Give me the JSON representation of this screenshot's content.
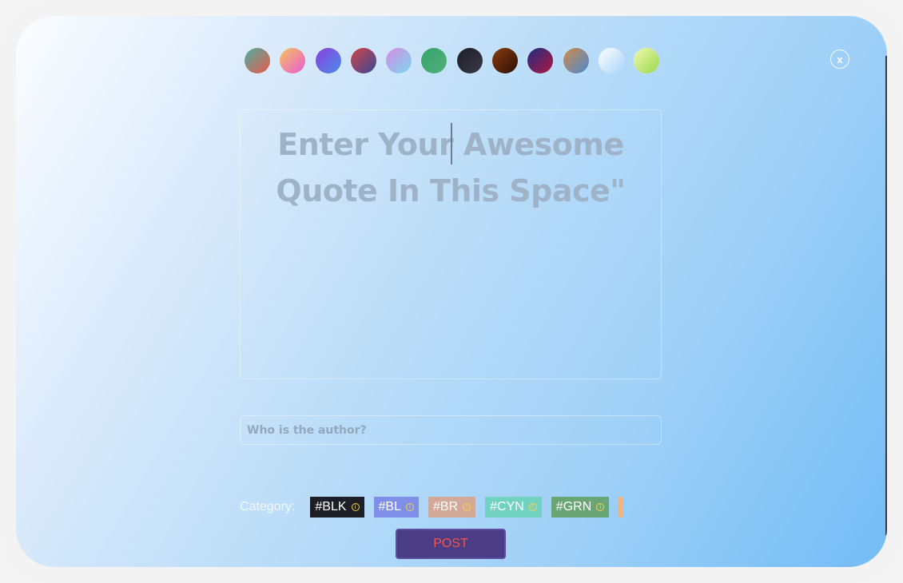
{
  "dialog": {
    "close_label": "x"
  },
  "color_swatches": [
    {
      "name": "teal-coral",
      "gradient": [
        "#4fb0a2",
        "#e8584a"
      ]
    },
    {
      "name": "orange-pink",
      "gradient": [
        "#f6c25b",
        "#e85bd6"
      ]
    },
    {
      "name": "violet-blue",
      "gradient": [
        "#8a3fe0",
        "#4a8fe8"
      ]
    },
    {
      "name": "red-indigo",
      "gradient": [
        "#d04344",
        "#3a4a9a"
      ]
    },
    {
      "name": "lilac-cyan",
      "gradient": [
        "#d68be0",
        "#7ad7f0"
      ]
    },
    {
      "name": "green",
      "gradient": [
        "#35a46a",
        "#52b07a"
      ]
    },
    {
      "name": "charcoal",
      "gradient": [
        "#1e1e2a",
        "#3a3a48"
      ]
    },
    {
      "name": "brown",
      "gradient": [
        "#8a3e10",
        "#2a0e04"
      ]
    },
    {
      "name": "navy-crimson",
      "gradient": [
        "#1d2d80",
        "#b01840"
      ]
    },
    {
      "name": "bronze-blue",
      "gradient": [
        "#d08a4a",
        "#4a8ad0"
      ]
    },
    {
      "name": "ice",
      "gradient": [
        "#ffffff",
        "#a8d4f8"
      ]
    },
    {
      "name": "lime",
      "gradient": [
        "#f0f8b0",
        "#9ad84a"
      ]
    }
  ],
  "quote": {
    "placeholder": "Enter Your Awesome Quote In This Space\""
  },
  "author": {
    "placeholder": "Who is the author?"
  },
  "category": {
    "label": "Category:",
    "tags": [
      {
        "label": "#BLK",
        "color": "#1e1f26"
      },
      {
        "label": "#BL",
        "color": "#7f8fe8"
      },
      {
        "label": "#BR",
        "color": "#d2a898"
      },
      {
        "label": "#CYN",
        "color": "#72d2c2"
      },
      {
        "label": "#GRN",
        "color": "#6aa576"
      }
    ],
    "overflow_color": "#f1b37d"
  },
  "post_button": {
    "label": "POST"
  }
}
